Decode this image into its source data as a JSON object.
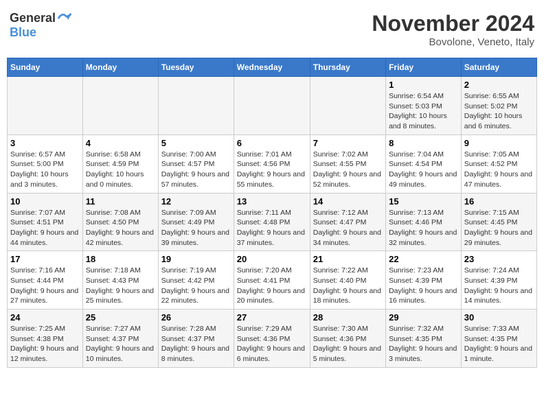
{
  "header": {
    "logo_line1": "General",
    "logo_line2": "Blue",
    "month_year": "November 2024",
    "location": "Bovolone, Veneto, Italy"
  },
  "weekdays": [
    "Sunday",
    "Monday",
    "Tuesday",
    "Wednesday",
    "Thursday",
    "Friday",
    "Saturday"
  ],
  "weeks": [
    [
      {
        "day": "",
        "info": ""
      },
      {
        "day": "",
        "info": ""
      },
      {
        "day": "",
        "info": ""
      },
      {
        "day": "",
        "info": ""
      },
      {
        "day": "",
        "info": ""
      },
      {
        "day": "1",
        "info": "Sunrise: 6:54 AM\nSunset: 5:03 PM\nDaylight: 10 hours and 8 minutes."
      },
      {
        "day": "2",
        "info": "Sunrise: 6:55 AM\nSunset: 5:02 PM\nDaylight: 10 hours and 6 minutes."
      }
    ],
    [
      {
        "day": "3",
        "info": "Sunrise: 6:57 AM\nSunset: 5:00 PM\nDaylight: 10 hours and 3 minutes."
      },
      {
        "day": "4",
        "info": "Sunrise: 6:58 AM\nSunset: 4:59 PM\nDaylight: 10 hours and 0 minutes."
      },
      {
        "day": "5",
        "info": "Sunrise: 7:00 AM\nSunset: 4:57 PM\nDaylight: 9 hours and 57 minutes."
      },
      {
        "day": "6",
        "info": "Sunrise: 7:01 AM\nSunset: 4:56 PM\nDaylight: 9 hours and 55 minutes."
      },
      {
        "day": "7",
        "info": "Sunrise: 7:02 AM\nSunset: 4:55 PM\nDaylight: 9 hours and 52 minutes."
      },
      {
        "day": "8",
        "info": "Sunrise: 7:04 AM\nSunset: 4:54 PM\nDaylight: 9 hours and 49 minutes."
      },
      {
        "day": "9",
        "info": "Sunrise: 7:05 AM\nSunset: 4:52 PM\nDaylight: 9 hours and 47 minutes."
      }
    ],
    [
      {
        "day": "10",
        "info": "Sunrise: 7:07 AM\nSunset: 4:51 PM\nDaylight: 9 hours and 44 minutes."
      },
      {
        "day": "11",
        "info": "Sunrise: 7:08 AM\nSunset: 4:50 PM\nDaylight: 9 hours and 42 minutes."
      },
      {
        "day": "12",
        "info": "Sunrise: 7:09 AM\nSunset: 4:49 PM\nDaylight: 9 hours and 39 minutes."
      },
      {
        "day": "13",
        "info": "Sunrise: 7:11 AM\nSunset: 4:48 PM\nDaylight: 9 hours and 37 minutes."
      },
      {
        "day": "14",
        "info": "Sunrise: 7:12 AM\nSunset: 4:47 PM\nDaylight: 9 hours and 34 minutes."
      },
      {
        "day": "15",
        "info": "Sunrise: 7:13 AM\nSunset: 4:46 PM\nDaylight: 9 hours and 32 minutes."
      },
      {
        "day": "16",
        "info": "Sunrise: 7:15 AM\nSunset: 4:45 PM\nDaylight: 9 hours and 29 minutes."
      }
    ],
    [
      {
        "day": "17",
        "info": "Sunrise: 7:16 AM\nSunset: 4:44 PM\nDaylight: 9 hours and 27 minutes."
      },
      {
        "day": "18",
        "info": "Sunrise: 7:18 AM\nSunset: 4:43 PM\nDaylight: 9 hours and 25 minutes."
      },
      {
        "day": "19",
        "info": "Sunrise: 7:19 AM\nSunset: 4:42 PM\nDaylight: 9 hours and 22 minutes."
      },
      {
        "day": "20",
        "info": "Sunrise: 7:20 AM\nSunset: 4:41 PM\nDaylight: 9 hours and 20 minutes."
      },
      {
        "day": "21",
        "info": "Sunrise: 7:22 AM\nSunset: 4:40 PM\nDaylight: 9 hours and 18 minutes."
      },
      {
        "day": "22",
        "info": "Sunrise: 7:23 AM\nSunset: 4:39 PM\nDaylight: 9 hours and 16 minutes."
      },
      {
        "day": "23",
        "info": "Sunrise: 7:24 AM\nSunset: 4:39 PM\nDaylight: 9 hours and 14 minutes."
      }
    ],
    [
      {
        "day": "24",
        "info": "Sunrise: 7:25 AM\nSunset: 4:38 PM\nDaylight: 9 hours and 12 minutes."
      },
      {
        "day": "25",
        "info": "Sunrise: 7:27 AM\nSunset: 4:37 PM\nDaylight: 9 hours and 10 minutes."
      },
      {
        "day": "26",
        "info": "Sunrise: 7:28 AM\nSunset: 4:37 PM\nDaylight: 9 hours and 8 minutes."
      },
      {
        "day": "27",
        "info": "Sunrise: 7:29 AM\nSunset: 4:36 PM\nDaylight: 9 hours and 6 minutes."
      },
      {
        "day": "28",
        "info": "Sunrise: 7:30 AM\nSunset: 4:36 PM\nDaylight: 9 hours and 5 minutes."
      },
      {
        "day": "29",
        "info": "Sunrise: 7:32 AM\nSunset: 4:35 PM\nDaylight: 9 hours and 3 minutes."
      },
      {
        "day": "30",
        "info": "Sunrise: 7:33 AM\nSunset: 4:35 PM\nDaylight: 9 hours and 1 minute."
      }
    ]
  ]
}
